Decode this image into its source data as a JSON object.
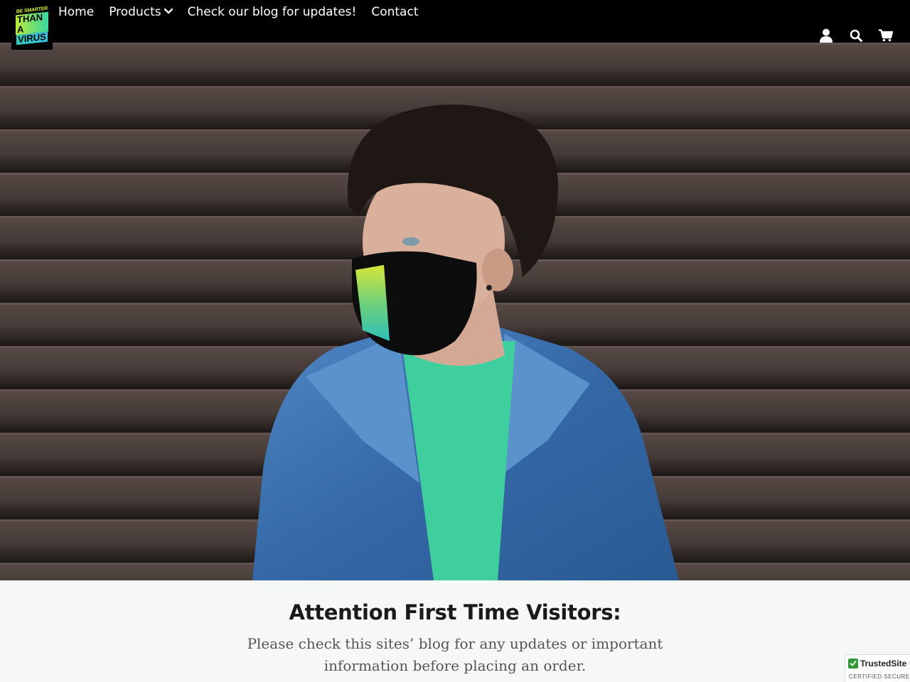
{
  "logo": {
    "line1": "BE SMARTER",
    "line2": "THAN A",
    "line3": "VIRUS"
  },
  "nav": {
    "home": "Home",
    "products": "Products",
    "blog": "Check our blog for updates!",
    "contact": "Contact"
  },
  "icons": [
    "user-icon",
    "search-icon",
    "cart-icon",
    "chevron-down-icon"
  ],
  "main": {
    "headline": "Attention First Time Visitors:",
    "body": "Please check this sites’ blog for any updates or important information before placing an order."
  },
  "badge": {
    "name": "TrustedSite",
    "sub": "CERTIFIED SECURE"
  },
  "colors": {
    "header_bg": "#000000",
    "content_bg": "#f6f7f7",
    "badge_green": "#2e9c34"
  }
}
